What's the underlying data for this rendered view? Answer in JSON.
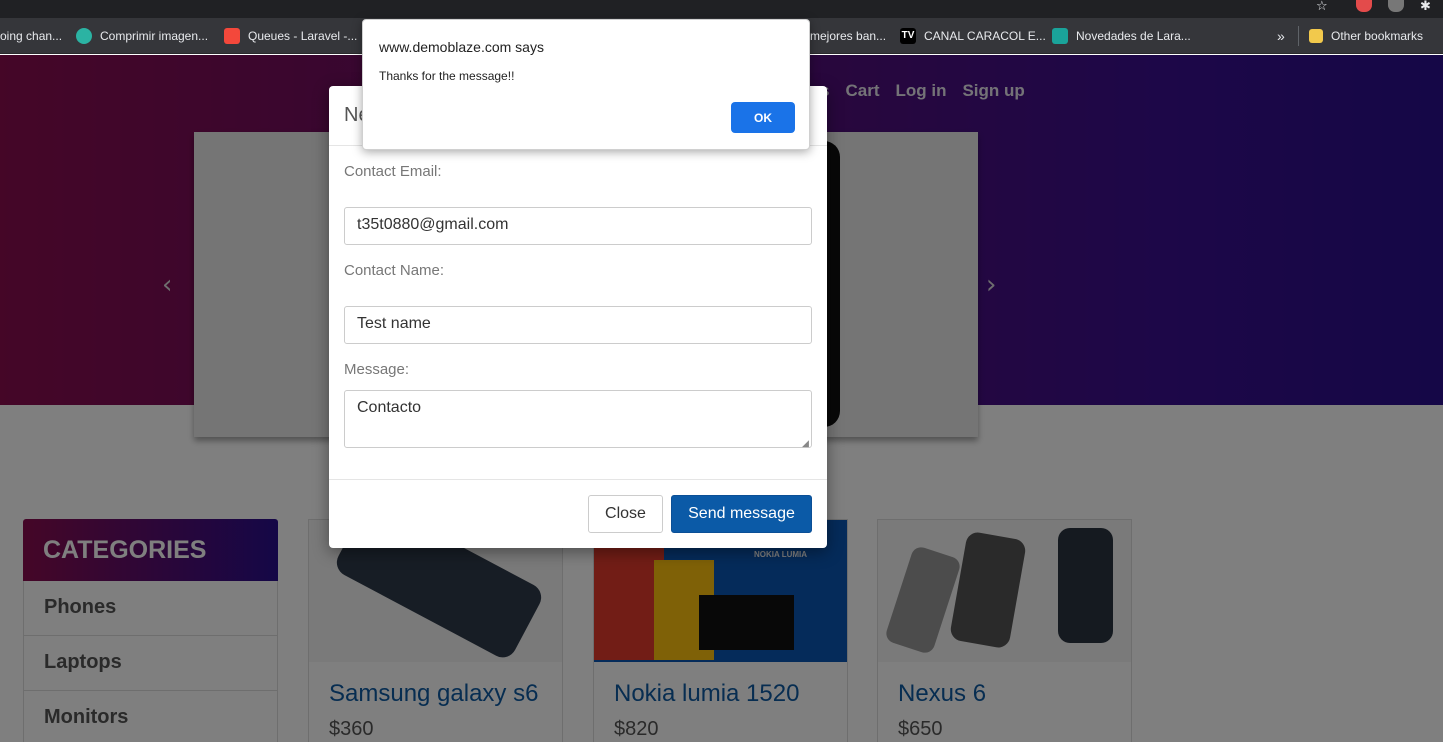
{
  "browser": {
    "bookmarks": [
      {
        "label": "oing chan...",
        "color": ""
      },
      {
        "label": "Comprimir imagen...",
        "color": "#2bb3a3"
      },
      {
        "label": "Queues - Laravel -...",
        "color": "#f4483b"
      },
      {
        "label": "mejores ban...",
        "color": ""
      },
      {
        "label": "CANAL CARACOL E...",
        "color": "#000000"
      },
      {
        "label": "Novedades de Lara...",
        "color": "#1aa39a"
      }
    ],
    "overflow_label": "»",
    "other_bookmarks_label": "Other bookmarks",
    "tv_badge": "TV"
  },
  "nav": {
    "items": [
      "s",
      "Cart",
      "Log in",
      "Sign up"
    ]
  },
  "categories": {
    "heading": "CATEGORIES",
    "items": [
      "Phones",
      "Laptops",
      "Monitors"
    ]
  },
  "products": [
    {
      "name": "Samsung galaxy s6",
      "price": "$360"
    },
    {
      "name": "Nokia lumia 1520",
      "price": "$820"
    },
    {
      "name": "Nexus 6",
      "price": "$650"
    }
  ],
  "nokia_banner_text": "NOKIA LUMIA",
  "modal": {
    "title_partial": "Ne",
    "email_label": "Contact Email:",
    "email_value": "t35t0880@gmail.com",
    "name_label": "Contact Name:",
    "name_value": "Test name",
    "message_label": "Message:",
    "message_value": "Contacto",
    "close_label": "Close",
    "send_label": "Send message"
  },
  "alert": {
    "origin": "www.demoblaze.com says",
    "message": "Thanks for the message!!",
    "ok_label": "OK",
    "ok_color": "#1a73e8"
  },
  "carousel": {
    "prev_icon": "chevron-left-icon",
    "next_icon": "chevron-right-icon"
  }
}
